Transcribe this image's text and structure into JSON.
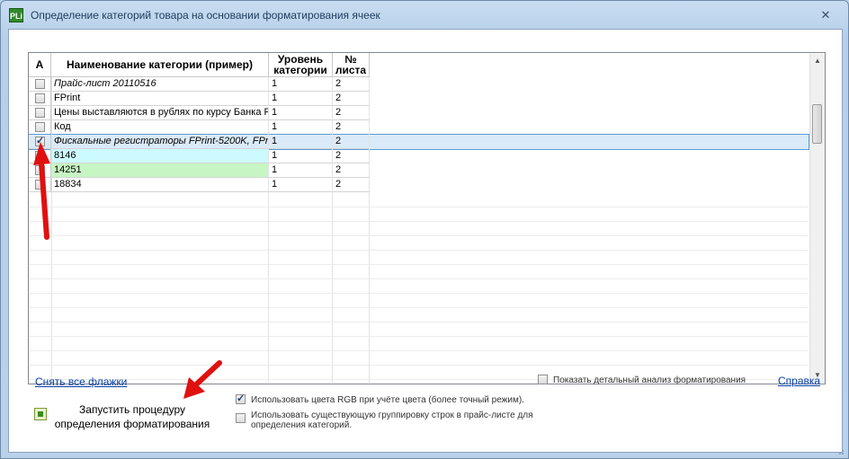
{
  "window": {
    "title": "Определение категорий товара на основании форматирования ячеек",
    "icon_text": "PLi",
    "close_glyph": "✕"
  },
  "grid": {
    "columns": [
      "A",
      "Наименование категории (пример)",
      "Уровень категории",
      "№ листа"
    ],
    "rows": [
      {
        "checked": false,
        "name": "Прайс-лист 20110516",
        "level": "1",
        "sheet": "2",
        "italic": true,
        "bg": ""
      },
      {
        "checked": false,
        "name": "FPrint",
        "level": "1",
        "sheet": "2",
        "italic": false,
        "bg": ""
      },
      {
        "checked": false,
        "name": "Цены выставляются в рублях по курсу Банка Р",
        "level": "1",
        "sheet": "2",
        "italic": false,
        "bg": ""
      },
      {
        "checked": false,
        "name": "Код",
        "level": "1",
        "sheet": "2",
        "italic": false,
        "bg": ""
      },
      {
        "checked": true,
        "name": "Фискальные регистраторы FPrint-5200K, FPrint-",
        "level": "1",
        "sheet": "2",
        "italic": true,
        "bg": "#daeaf8"
      },
      {
        "checked": false,
        "name": "8146",
        "level": "1",
        "sheet": "2",
        "italic": false,
        "bg": "#ccfaff"
      },
      {
        "checked": false,
        "name": "14251",
        "level": "1",
        "sheet": "2",
        "italic": false,
        "bg": "#c8f5c4"
      },
      {
        "checked": false,
        "name": "18834",
        "level": "1",
        "sheet": "2",
        "italic": false,
        "bg": ""
      }
    ]
  },
  "footer": {
    "clear_flags_link": "Снять все флажки",
    "show_analysis_label": "Показать детальный анализ форматирования",
    "help_link": "Справка",
    "run_button_label": "Запустить процедуру определения форматирования",
    "use_rgb_label": "Использовать цвета RGB при учёте цвета (более точный режим).",
    "use_grouping_label": "Использовать существующую группировку строк в прайс-листе для определения категорий."
  },
  "colors": {
    "accent_link": "#0b40a8",
    "arrow": "#e01010",
    "selected_row": "#daeaf8"
  }
}
